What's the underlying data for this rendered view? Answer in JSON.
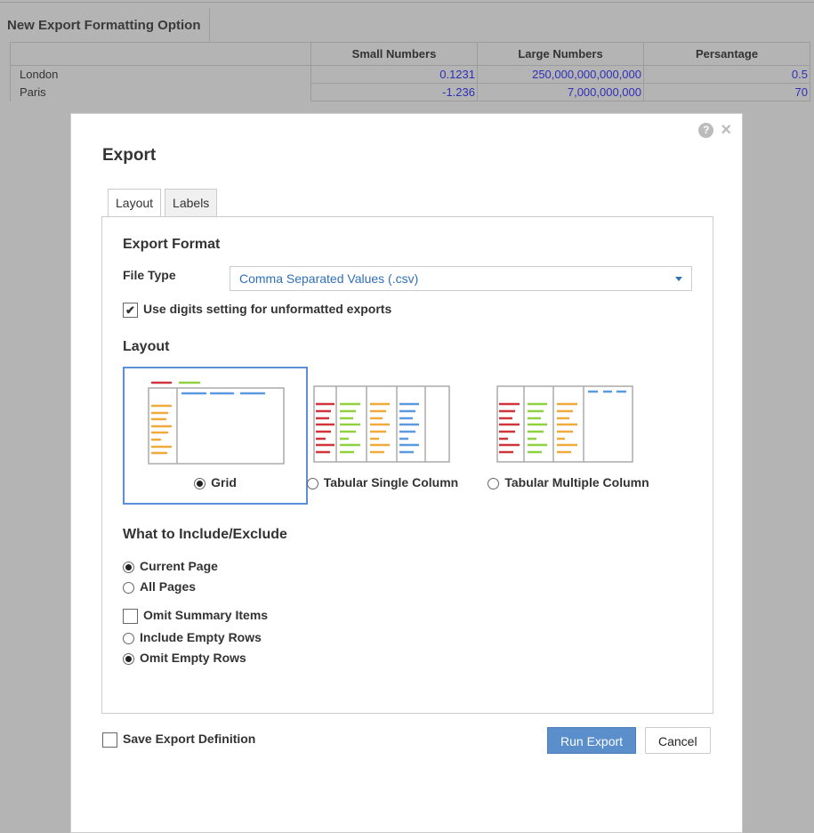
{
  "report": {
    "title": "New Export Formatting Option",
    "columns": [
      "",
      "Small Numbers",
      "Large Numbers",
      "Persantage"
    ],
    "rows": [
      {
        "label": "London",
        "values": [
          "0.1231",
          "250,000,000,000,000",
          "0.5"
        ]
      },
      {
        "label": "Paris",
        "values": [
          "-1.236",
          "7,000,000,000",
          "70"
        ]
      }
    ]
  },
  "dialog": {
    "title": "Export",
    "tabs": [
      "Layout",
      "Labels"
    ],
    "export_format_heading": "Export Format",
    "file_type_label": "File Type",
    "file_type_value": "Comma Separated Values (.csv)",
    "use_digits_label": "Use digits setting for unformatted exports",
    "use_digits_checked": true,
    "layout_heading": "Layout",
    "layouts": [
      "Grid",
      "Tabular Single Column",
      "Tabular Multiple Column"
    ],
    "selected_layout": "Grid",
    "include_heading": "What to Include/Exclude",
    "current_page": "Current Page",
    "all_pages": "All Pages",
    "omit_summary": "Omit Summary Items",
    "include_empty": "Include Empty Rows",
    "omit_empty": "Omit Empty Rows",
    "save_definition": "Save Export Definition",
    "run_export": "Run Export",
    "cancel": "Cancel",
    "colors": {
      "accent": "#5a8fcc",
      "red": "#d0343c",
      "green": "#8fd13f",
      "orange": "#f0aa3c",
      "blue": "#5b9ae0"
    }
  }
}
